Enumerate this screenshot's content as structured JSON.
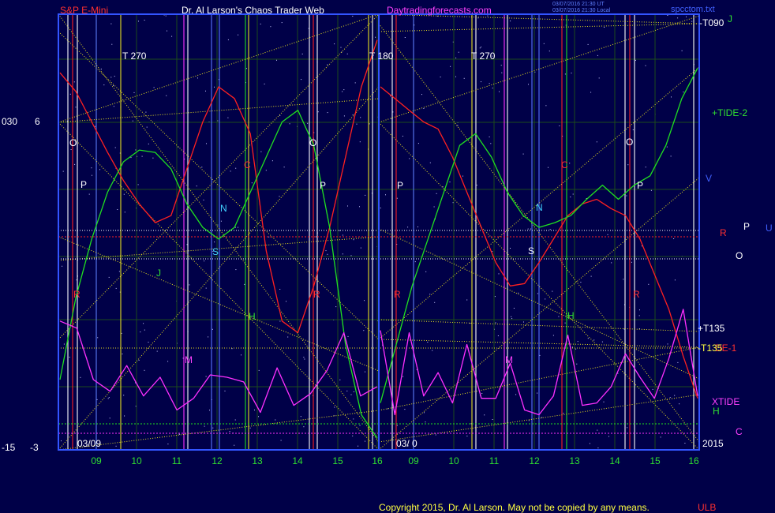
{
  "header": {
    "left_title": "S&P E-Mini",
    "center_title": "Dr. Al Larson's Chaos Trader Web",
    "site": "Daytradingforecasts.com",
    "stamp_line1": "03/07/2016 21:30 UT",
    "stamp_line2": "03/07/2016 21:30 Local",
    "filename": "spcctom.txt"
  },
  "footer": {
    "copyright": "Copyright 2015, Dr. Al Larson. May not be copied by any means.",
    "corner": "ULB"
  },
  "left_scale": {
    "top_a": "030",
    "top_b": "6",
    "bottom_a": "-15",
    "bottom_b": "-3"
  },
  "date_labels": {
    "left_date": "03/09",
    "right_date": "03/ 0",
    "year": "2015"
  },
  "right_labels": {
    "t090": "-T090",
    "j": "J",
    "tide2": "+TIDE-2",
    "v": "V",
    "r": "R",
    "p": "P",
    "u": "U",
    "o": "O",
    "t135p": "+T135",
    "t135m": "-T135",
    "de1": "DE-1",
    "xtide": "XTIDE",
    "h": "H",
    "c": "C"
  },
  "markers": {
    "t270a": "T  270",
    "t180": "T  180",
    "t270b": "T  270",
    "o1": "O",
    "o2": "O",
    "o3": "O",
    "p1": "P",
    "p2": "P",
    "p3": "P",
    "p4": "P",
    "c1": "C",
    "c2": "C",
    "j1": "J",
    "n1": "N",
    "n2": "N",
    "s1": "S",
    "s2": "S",
    "r1": "R",
    "r2": "R",
    "r3": "R",
    "r4": "R",
    "h1": "H",
    "h2": "H",
    "m1": "M",
    "m2": "M"
  },
  "colors": {
    "background": "#000048",
    "grid": "#1c4a1c",
    "frame": "#3355ff",
    "red_line": "#ff2020",
    "green_line": "#20e020",
    "magenta_line": "#ff30ff",
    "yellow_line": "#e8e020",
    "white_line": "#ffffff",
    "blue_vertical": "#5a78ff",
    "label_red": "#ff3030",
    "label_white": "#ffffff",
    "label_yellow": "#ffff40",
    "label_cyan": "#40d0ff",
    "label_magenta": "#ff40ff",
    "label_green": "#30e030"
  },
  "chart_data": {
    "type": "line",
    "x_axis_labels": [
      "09",
      "10",
      "11",
      "12",
      "13",
      "14",
      "15",
      "16",
      "09",
      "10",
      "11",
      "12",
      "13",
      "14",
      "15",
      "16"
    ],
    "series": [
      {
        "values": [
          5.6,
          4.8,
          3.5,
          2.2,
          1.0,
          0.0,
          -0.8,
          -0.5,
          1.5,
          3.5,
          5.0,
          4.5,
          3.0,
          -2.0,
          -5.0,
          -5.5,
          -3.5,
          -1.0,
          2.0,
          5.0,
          7.0,
          5.0,
          4.5,
          4.0,
          3.5,
          3.2,
          2.0,
          0.5,
          -1.0,
          -2.5,
          -3.5,
          -3.4,
          -2.5,
          -1.5,
          -0.5,
          0.0,
          0.2,
          -0.2,
          -0.5,
          -1.5,
          -3.0,
          -4.5,
          -6.5,
          -8.3
        ]
      },
      {
        "values": [
          -7.5,
          -4.0,
          -1.5,
          0.5,
          1.8,
          2.3,
          2.2,
          1.5,
          0.0,
          -1.0,
          -1.5,
          -1.0,
          0.5,
          2.0,
          3.5,
          4.0,
          2.5,
          -1.0,
          -6.0,
          -9.0,
          -10.0,
          -8.5,
          -6.0,
          -3.5,
          -1.5,
          0.5,
          2.5,
          3.0,
          2.0,
          0.5,
          -0.5,
          -1.0,
          -0.8,
          -0.5,
          0.2,
          0.8,
          0.2,
          0.8,
          1.2,
          2.5,
          4.5,
          5.8
        ]
      },
      {
        "values": [
          -5.0,
          -5.3,
          -7.5,
          -8.0,
          -6.9,
          -8.2,
          -7.4,
          -8.8,
          -8.3,
          -7.3,
          -7.4,
          -7.6,
          -8.9,
          -7.0,
          -8.6,
          -8.1,
          -7.1,
          -5.5,
          -8.2,
          -7.8,
          -5.4,
          -9.0,
          -5.5,
          -8.2,
          -7.2,
          -8.5,
          -6.0,
          -8.3,
          -8.3,
          -6.8,
          -8.8,
          -9.0,
          -8.2,
          -5.6,
          -8.6,
          -8.5,
          -7.8,
          -6.4,
          -7.4,
          -8.3,
          -6.6,
          -4.5,
          -8.2
        ]
      }
    ],
    "ylim": [
      -10.5,
      8.1
    ]
  }
}
